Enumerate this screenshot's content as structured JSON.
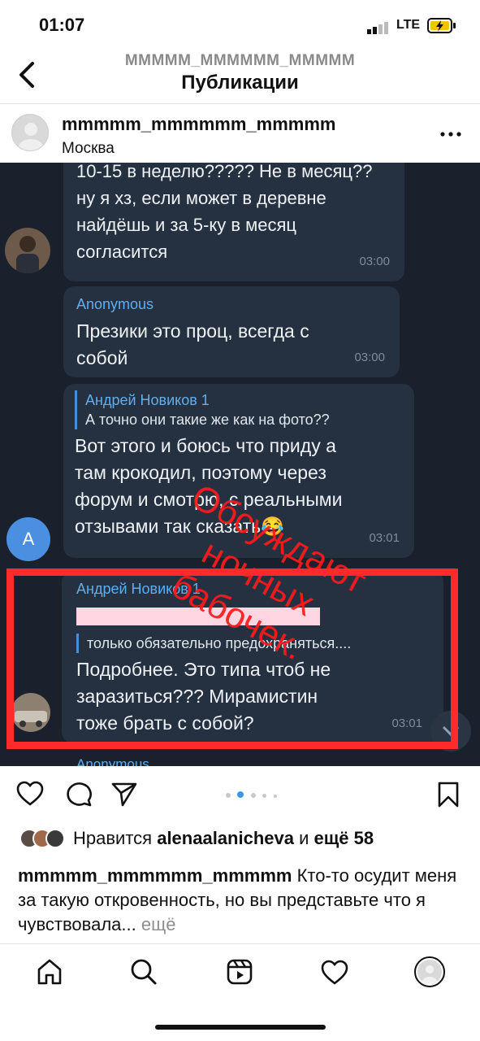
{
  "status": {
    "time": "01:07",
    "network": "LTE"
  },
  "header": {
    "username": "MMMMM_MMMMMM_MMMMM",
    "title": "Публикации"
  },
  "post": {
    "username": "mmmmm_mmmmmm_mmmmm",
    "location": "Москва"
  },
  "chat": {
    "msg1": {
      "text": "10-15 в неделю????? Не в месяц??\nну я хз, если может в деревне\nнайдёшь и за 5-ку в месяц\nсогласится",
      "time": "03:00"
    },
    "msg2": {
      "sender": "Anonymous",
      "text": "Презики это проц, всегда с\nсобой",
      "time": "03:00"
    },
    "msg3": {
      "quote_name": "Андрей Новиков 1",
      "quote_text": "А точно они такие же как на фото??",
      "text": "Вот этого и боюсь что приду а\nтам крокодил, поэтому через\nфорум и смотрю, с реальными\nотзывами так сказать😂",
      "time": "03:01",
      "avatar_letter": "A"
    },
    "msg4": {
      "sender": "Андрей Новиков 1",
      "quote_text": "только обязательно предохраняться....",
      "text": "Подробнее. Это типа чтоб не\nзаразиться??? Мирамистин\nтоже брать с собой?",
      "time": "03:01"
    },
    "next_sender_partial": "Anonymous",
    "overlay": "Обсуждают\nночных\nбабочек."
  },
  "likes": {
    "prefix": "Нравится ",
    "user": "alenaalanicheva",
    "middle": " и ",
    "count": "ещё 58"
  },
  "caption": {
    "username": "mmmmm_mmmmmm_mmmmm",
    "text": " Кто-то осудит меня за такую откровенность, но вы представьте что я чувствовала... ",
    "more": "ещё"
  },
  "carousel": {
    "total": 5,
    "active": 1
  },
  "colors": {
    "chat_bg": "#1a212c",
    "bubble": "#253141",
    "highlight": "#ff2a2a",
    "accent": "#3897f0"
  },
  "icons": [
    "back-chevron-icon",
    "more-dots-icon",
    "heart-icon",
    "comment-icon",
    "share-icon",
    "bookmark-icon",
    "home-icon",
    "search-icon",
    "reels-icon",
    "activity-heart-icon",
    "profile-icon"
  ]
}
